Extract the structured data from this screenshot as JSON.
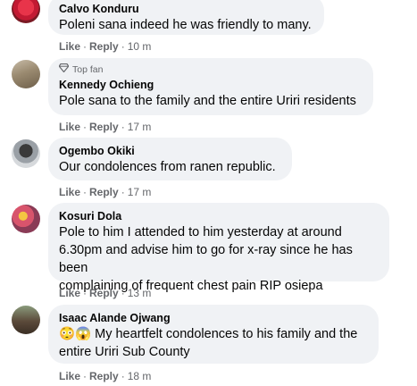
{
  "comments": [
    {
      "author": "Calvo Konduru",
      "text": "Poleni sana indeed he was friendly to many.",
      "like": "Like",
      "reply": "Reply",
      "separator": "·",
      "time": "10 m"
    },
    {
      "badge": "Top fan",
      "author": "Kennedy Ochieng",
      "text": "Pole sana to the family and the entire Uriri residents",
      "like": "Like",
      "reply": "Reply",
      "separator": "·",
      "time": "17 m"
    },
    {
      "author": "Ogembo Okiki",
      "text": "Our condolences from ranen republic.",
      "like": "Like",
      "reply": "Reply",
      "separator": "·",
      "time": "17 m"
    },
    {
      "author": "Kosuri Dola",
      "text_lines": [
        "Pole to him I attended to him yesterday at around",
        "6.30pm and advise him to go for x-ray since he has been",
        "complaining of frequent chest pain RIP osiepa"
      ],
      "like": "Like",
      "reply": "Reply",
      "separator": "·",
      "time": "13 m"
    },
    {
      "author": "Isaac Alande Ojwang",
      "emoji": "😳😱",
      "text_lines": [
        "My heartfelt condolences to his family and the",
        "entire Uriri Sub County"
      ],
      "like": "Like",
      "reply": "Reply",
      "separator": "·",
      "time": "18 m"
    }
  ],
  "colors": {
    "bubble": "#f0f2f5",
    "meta": "#65676b",
    "text": "#050505",
    "top_fan_icon": "#65676b"
  }
}
